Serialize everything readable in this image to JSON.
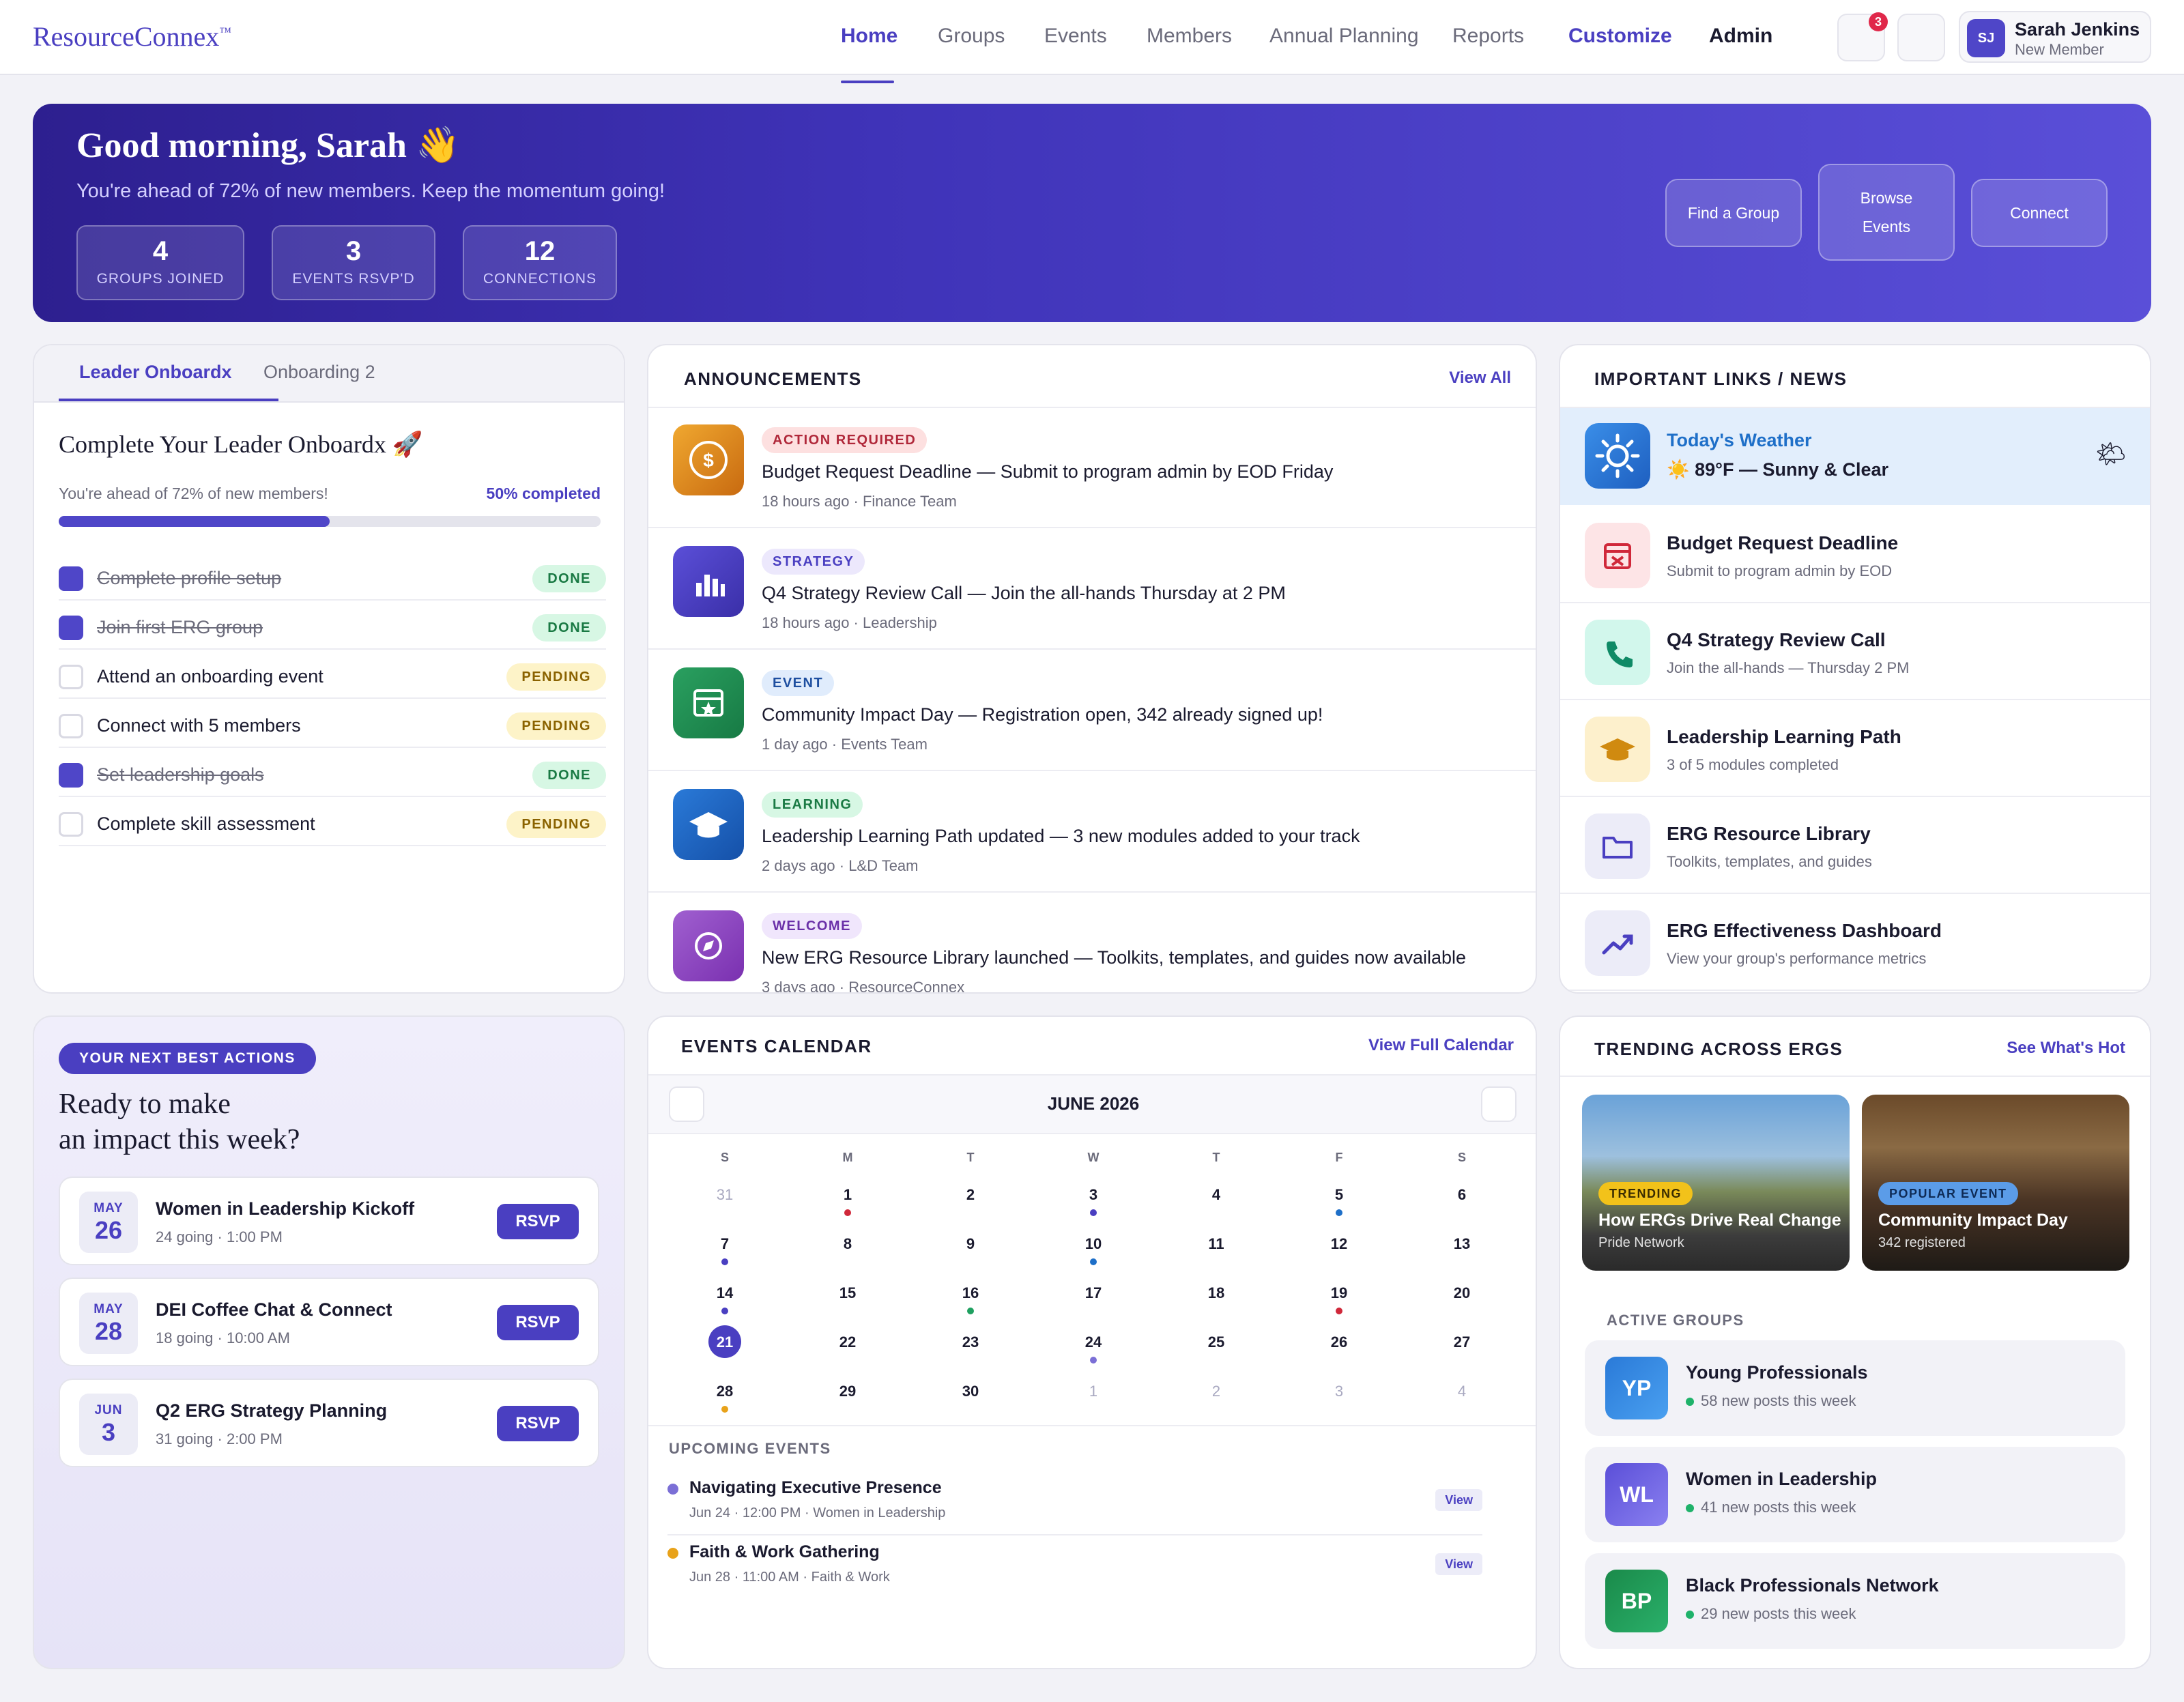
{
  "app": {
    "logo": "ResourceConnex",
    "logo_tm": "™"
  },
  "nav": {
    "items": [
      "Home",
      "Groups",
      "Events",
      "Members",
      "Annual Planning",
      "Reports"
    ],
    "customize": "Customize",
    "admin": "Admin",
    "notification_count": "3",
    "user": {
      "initials": "SJ",
      "name": "Sarah Jenkins",
      "role": "New Member"
    }
  },
  "hero": {
    "greeting": "Good morning, Sarah 👋",
    "subtitle": "You're ahead of 72% of new members. Keep the momentum going!",
    "stats": [
      {
        "value": "4",
        "label": "GROUPS JOINED"
      },
      {
        "value": "3",
        "label": "EVENTS RSVP'D"
      },
      {
        "value": "12",
        "label": "CONNECTIONS"
      }
    ],
    "buttons": {
      "find_group": "Find a Group",
      "browse_1": "Browse",
      "browse_2": "Events",
      "connect": "Connect"
    }
  },
  "onboarding": {
    "tabs": [
      "Leader Onboardx",
      "Onboarding 2"
    ],
    "title": "Complete Your Leader Onboardx 🚀",
    "progress_text": "You're ahead of 72% of new members!",
    "progress_label": "50% completed",
    "progress": 0.5,
    "tasks": [
      {
        "label": "Complete profile setup",
        "status": "DONE"
      },
      {
        "label": "Join first ERG group",
        "status": "DONE"
      },
      {
        "label": "Attend an onboarding event",
        "status": "PENDING"
      },
      {
        "label": "Connect with 5 members",
        "status": "PENDING"
      },
      {
        "label": "Set leadership goals",
        "status": "DONE"
      },
      {
        "label": "Complete skill assessment",
        "status": "PENDING"
      }
    ]
  },
  "announcements": {
    "title": "ANNOUNCEMENTS",
    "view_all": "View All",
    "items": [
      {
        "tag": "ACTION REQUIRED",
        "title": "Budget Request Deadline — Submit to program admin by EOD Friday",
        "meta": "18 hours ago · Finance Team",
        "icon": "dollar-icon"
      },
      {
        "tag": "STRATEGY",
        "title": "Q4 Strategy Review Call — Join the all-hands Thursday at 2 PM",
        "meta": "18 hours ago · Leadership",
        "icon": "chart-icon"
      },
      {
        "tag": "EVENT",
        "title": "Community Impact Day — Registration open, 342 already signed up!",
        "meta": "1 day ago · Events Team",
        "icon": "calendar-star-icon"
      },
      {
        "tag": "LEARNING",
        "title": "Leadership Learning Path updated — 3 new modules added to your track",
        "meta": "2 days ago · L&D Team",
        "icon": "graduation-cap-icon"
      },
      {
        "tag": "WELCOME",
        "title": "New ERG Resource Library launched — Toolkits, templates, and guides now available",
        "meta": "3 days ago · ResourceConnex",
        "icon": "compass-icon"
      }
    ]
  },
  "links": {
    "title": "IMPORTANT LINKS / NEWS",
    "weather": {
      "title": "Today's Weather",
      "value": "☀️ 89°F — Sunny & Clear"
    },
    "items": [
      {
        "title": "Budget Request Deadline",
        "sub": "Submit to program admin by EOD",
        "icon": "calendar-x-icon"
      },
      {
        "title": "Q4 Strategy Review Call",
        "sub": "Join the all-hands — Thursday 2 PM",
        "icon": "phone-icon"
      },
      {
        "title": "Leadership Learning Path",
        "sub": "3 of 5 modules completed",
        "icon": "graduation-cap-icon"
      },
      {
        "title": "ERG Resource Library",
        "sub": "Toolkits, templates, and guides",
        "icon": "folder-icon"
      },
      {
        "title": "ERG Effectiveness Dashboard",
        "sub": "View your group's performance metrics",
        "icon": "trend-up-icon"
      }
    ]
  },
  "next_actions": {
    "badge": "YOUR NEXT BEST ACTIONS",
    "title_1": "Ready to make",
    "title_2": "an impact this week?",
    "rsvp": "RSVP",
    "items": [
      {
        "mon": "MAY",
        "day": "26",
        "title": "Women in Leadership Kickoff",
        "sub": "24 going · 1:00 PM"
      },
      {
        "mon": "MAY",
        "day": "28",
        "title": "DEI Coffee Chat & Connect",
        "sub": "18 going · 10:00 AM"
      },
      {
        "mon": "JUN",
        "day": "3",
        "title": "Q2 ERG Strategy Planning",
        "sub": "31 going · 2:00 PM"
      }
    ]
  },
  "calendar": {
    "title": "EVENTS CALENDAR",
    "view_full": "View Full Calendar",
    "month": "JUNE 2026",
    "weekdays": [
      "S",
      "M",
      "T",
      "W",
      "T",
      "F",
      "S"
    ],
    "days": [
      "31",
      "1",
      "2",
      "3",
      "4",
      "5",
      "6",
      "7",
      "8",
      "9",
      "10",
      "11",
      "12",
      "13",
      "14",
      "15",
      "16",
      "17",
      "18",
      "19",
      "20",
      "21",
      "22",
      "23",
      "24",
      "25",
      "26",
      "27",
      "28",
      "29",
      "30",
      "1",
      "2",
      "3",
      "4"
    ],
    "today": "21",
    "upcoming_label": "UPCOMING EVENTS",
    "upcoming": [
      {
        "title": "Navigating Executive Presence",
        "meta": "Jun 24 · 12:00 PM · Women in Leadership",
        "color": "#7b6fd6",
        "action": "View"
      },
      {
        "title": "Faith & Work Gathering",
        "meta": "Jun 28 · 11:00 AM · Faith & Work",
        "color": "#e8a21a",
        "action": "View"
      }
    ]
  },
  "trending": {
    "title": "TRENDING ACROSS ERGS",
    "see_hot": "See What's Hot",
    "cards": [
      {
        "tag": "TRENDING",
        "title": "How ERGs Drive Real Change",
        "sub": "Pride Network"
      },
      {
        "tag": "POPULAR EVENT",
        "title": "Community Impact Day",
        "sub": "342 registered"
      }
    ],
    "active_label": "ACTIVE GROUPS",
    "groups": [
      {
        "initials": "YP",
        "name": "Young Professionals",
        "sub": "58 new posts this week"
      },
      {
        "initials": "WL",
        "name": "Women in Leadership",
        "sub": "41 new posts this week"
      },
      {
        "initials": "BP",
        "name": "Black Professionals Network",
        "sub": "29 new posts this week"
      }
    ]
  },
  "colors": {
    "accent": "#4a3fc1",
    "done": "#1a7a44",
    "pending": "#8a6200"
  }
}
